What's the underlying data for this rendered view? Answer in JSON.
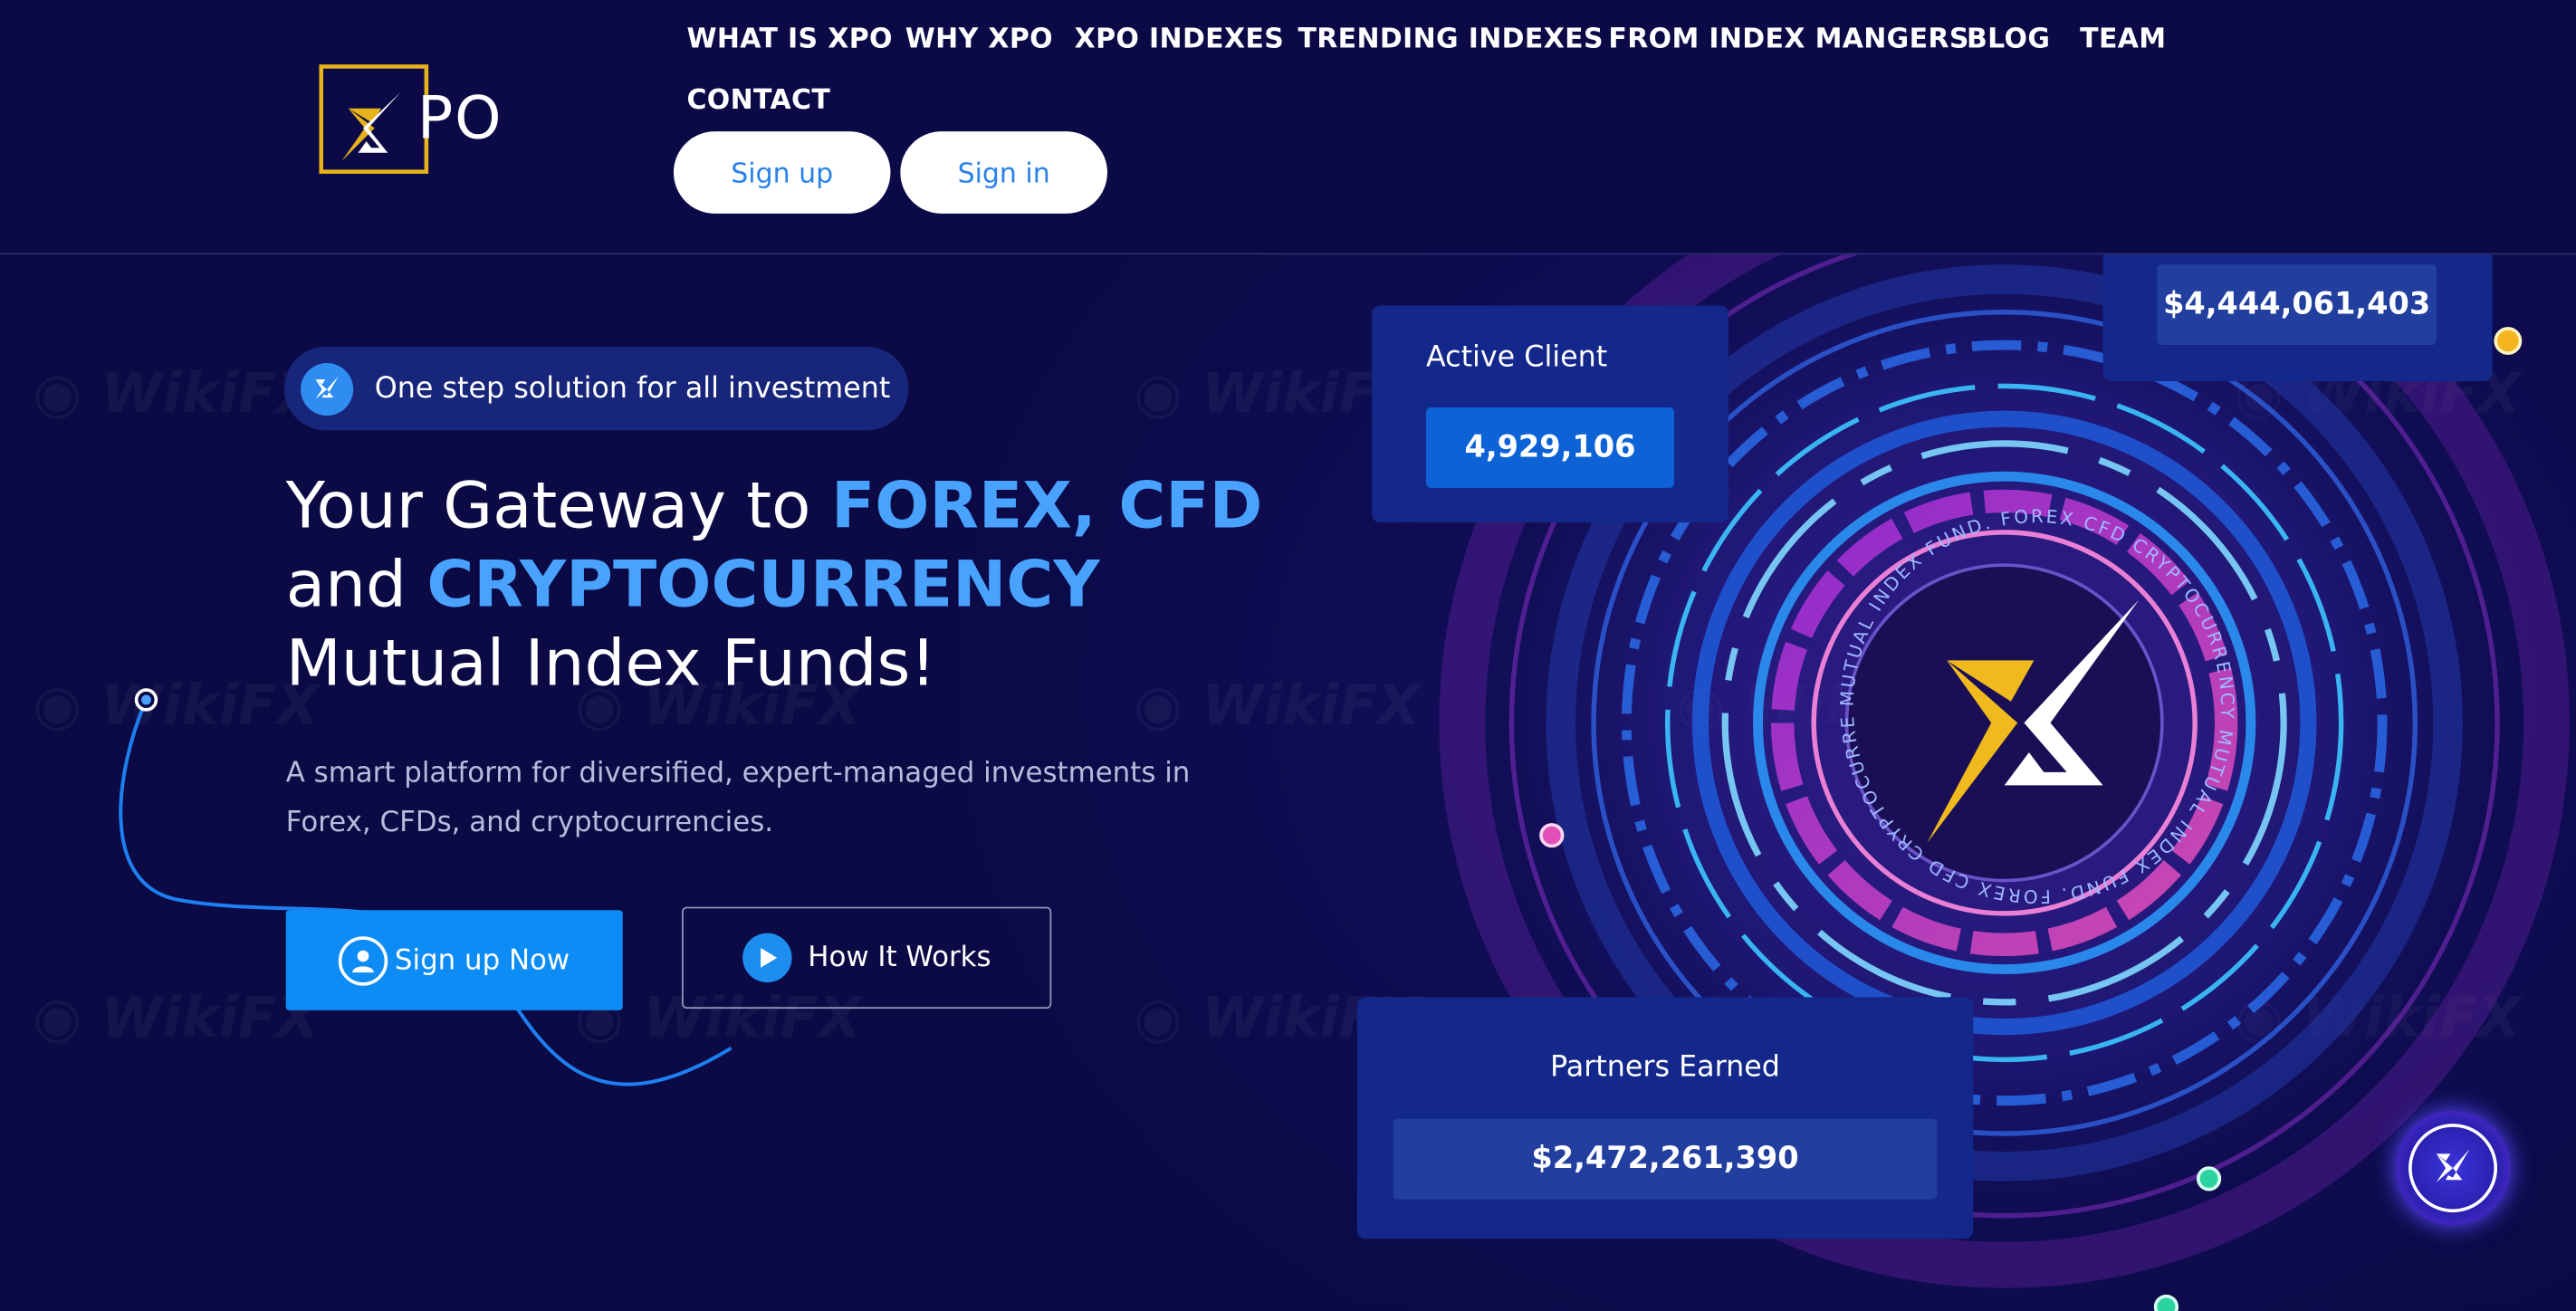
{
  "header": {
    "logo_text": "PO",
    "nav": [
      "WHAT IS XPO",
      "WHY XPO",
      "XPO INDEXES",
      "TRENDING INDEXES",
      "FROM INDEX MANGERS",
      "BLOG",
      "TEAM",
      "CONTACT"
    ],
    "signup_label": "Sign up",
    "signin_label": "Sign in"
  },
  "hero": {
    "badge_text": "One step solution for all investment",
    "headline_part1": "Your Gateway to ",
    "headline_highlight1": "FOREX, CFD",
    "headline_part2": "and ",
    "headline_highlight2": "CRYPTOCURRENCY",
    "headline_part3": "Mutual Index Funds!",
    "subtext": "A smart platform for diversified, expert-managed investments in Forex, CFDs, and cryptocurrencies.",
    "primary_button": "Sign up Now",
    "secondary_button": "How It Works"
  },
  "stats": {
    "active_client_label": "Active Client",
    "active_client_value": "4,929,106",
    "top_value": "$4,444,061,403",
    "partners_label": "Partners Earned",
    "partners_value": "$2,472,261,390"
  },
  "emblem": {
    "ring_text": "MUTUAL INDEX FUND. FOREX CFD CRYPTOCURRENCY MUTUAL INDEX FUND. FOREX CFD CRYPTOCURRENCY"
  },
  "colors": {
    "background": "#0b0a45",
    "accent_blue": "#0c8cf4",
    "highlight_text": "#4aa2ff",
    "card": "#13288a",
    "logo_gold": "#e8b21a"
  },
  "icons": {
    "badge": "xpo-mark-icon",
    "signup_now": "user-icon",
    "how_it_works": "play-icon",
    "floating": "xpo-chat-icon"
  }
}
